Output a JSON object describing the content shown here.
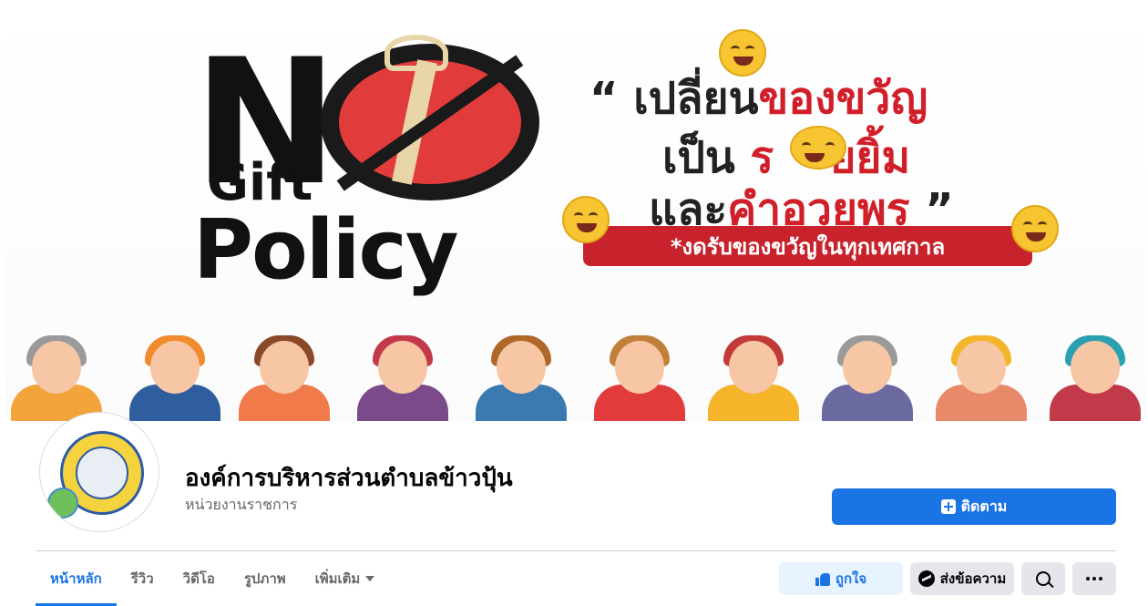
{
  "cover": {
    "no_letter": "N",
    "gift_word": "Gift",
    "policy_word": "Policy",
    "quote_line1_black": "“ เปลี่ยน",
    "quote_line1_red": "ของขวัญ",
    "quote_line2_black": "เป็น",
    "quote_line2_red_a": "ร",
    "quote_line2_red_b": "ยยิ้ม",
    "quote_line3_black": "และ",
    "quote_line3_red": "คำอวยพร",
    "quote_line3_close": " ”",
    "banner_text": "*งดรับของขวัญในทุกเทศกาล",
    "emoji_icons": [
      "smiling-emoji-icon",
      "heart-eyes-emoji-icon",
      "smiling-emoji-icon",
      "smiling-emoji-icon"
    ]
  },
  "profile": {
    "page_name": "องค์การบริหารส่วนตำบลข้าวปุ้น",
    "category": "หน่วยงานราชการ",
    "follow_label": "ติดตาม"
  },
  "tabs": [
    {
      "label": "หน้าหลัก",
      "active": true
    },
    {
      "label": "รีวิว",
      "active": false
    },
    {
      "label": "วิดีโอ",
      "active": false
    },
    {
      "label": "รูปภาพ",
      "active": false
    },
    {
      "label": "เพิ่มเติม",
      "active": false
    }
  ],
  "actions": {
    "like_label": "ถูกใจ",
    "message_label": "ส่งข้อความ"
  },
  "colors": {
    "primary_blue": "#1b74e4",
    "like_bg": "#e7f3ff",
    "secondary_bg": "#e4e6eb",
    "banner_red": "#c8232c"
  }
}
